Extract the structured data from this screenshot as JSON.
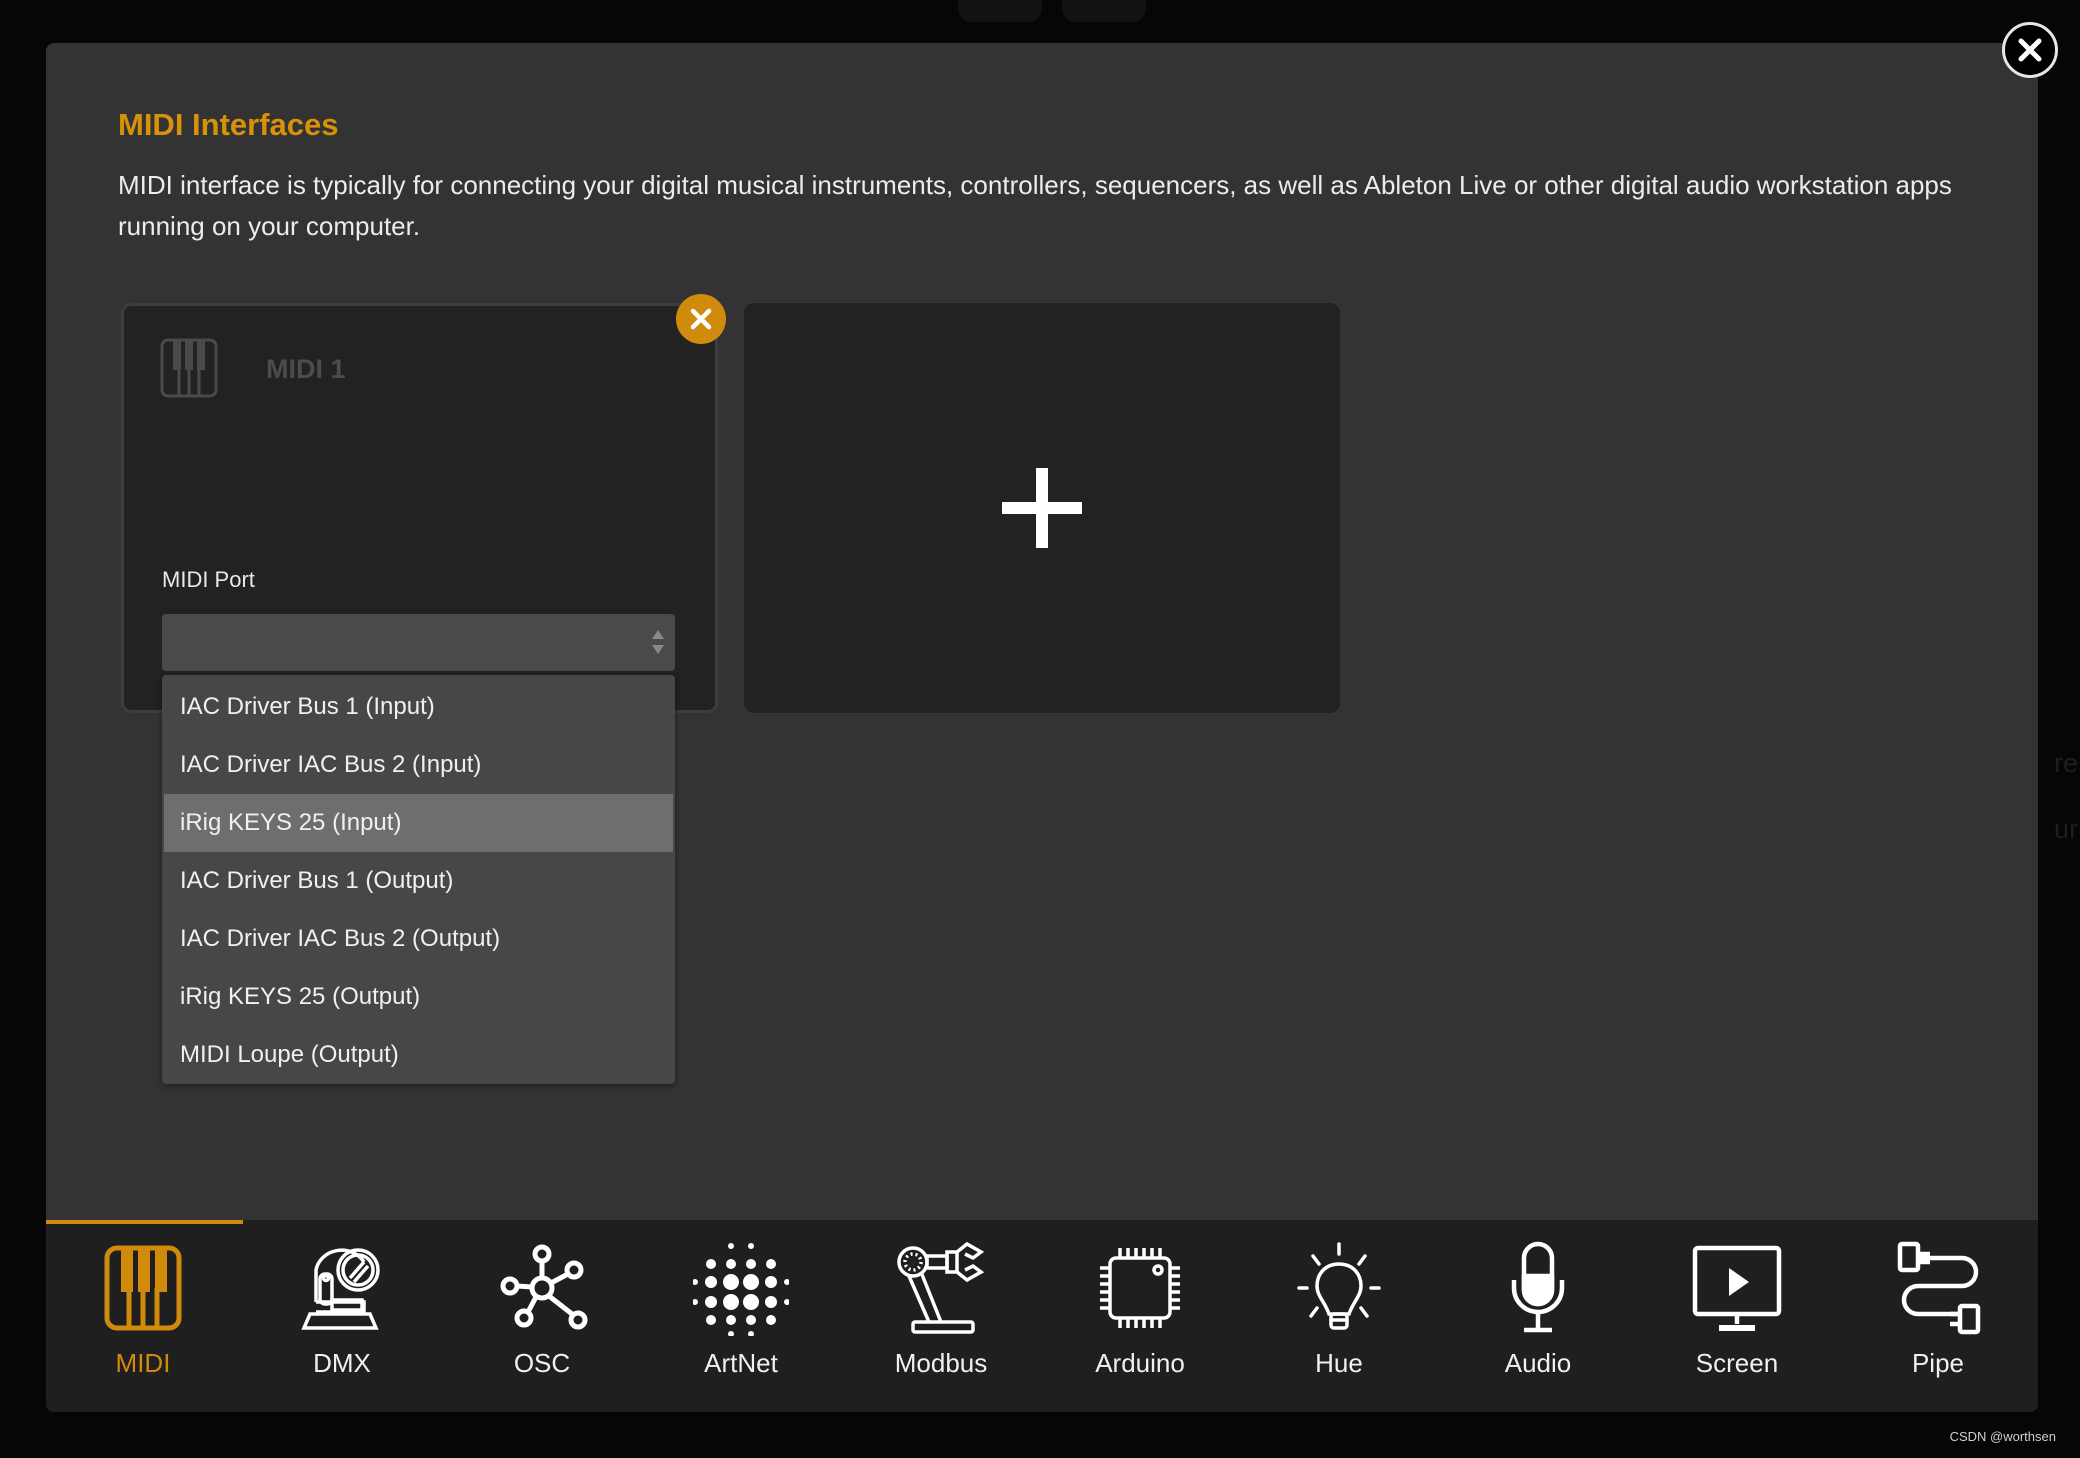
{
  "page": {
    "title": "MIDI Interfaces",
    "description": "MIDI interface is typically for connecting your digital musical instruments, controllers, sequencers, as well as Ableton Live or other digital audio workstation apps running on your computer.",
    "accent_color": "#d08a0c",
    "background_ghost_text": [
      "re",
      "ur"
    ]
  },
  "interface_card": {
    "name": "MIDI 1",
    "icon": "piano-keys-icon",
    "port_label": "MIDI Port",
    "port_value": "",
    "remove_icon": "close-icon"
  },
  "add_card": {
    "icon": "plus-icon"
  },
  "dropdown": {
    "highlighted_index": 2,
    "options": [
      "IAC Driver Bus 1 (Input)",
      "IAC Driver IAC Bus 2 (Input)",
      "iRig KEYS 25 (Input)",
      "IAC Driver Bus 1 (Output)",
      "IAC Driver IAC Bus 2 (Output)",
      "iRig KEYS 25 (Output)",
      "MIDI Loupe (Output)"
    ]
  },
  "nav": {
    "active_index": 0,
    "items": [
      {
        "label": "MIDI",
        "icon": "piano-keys-icon"
      },
      {
        "label": "DMX",
        "icon": "moving-head-light-icon"
      },
      {
        "label": "OSC",
        "icon": "network-nodes-icon"
      },
      {
        "label": "ArtNet",
        "icon": "dot-matrix-icon"
      },
      {
        "label": "Modbus",
        "icon": "robot-arm-icon"
      },
      {
        "label": "Arduino",
        "icon": "microchip-icon"
      },
      {
        "label": "Hue",
        "icon": "light-bulb-icon"
      },
      {
        "label": "Audio",
        "icon": "microphone-icon"
      },
      {
        "label": "Screen",
        "icon": "monitor-play-icon"
      },
      {
        "label": "Pipe",
        "icon": "pipe-connector-icon"
      }
    ]
  },
  "watermark": "CSDN @worthsen"
}
